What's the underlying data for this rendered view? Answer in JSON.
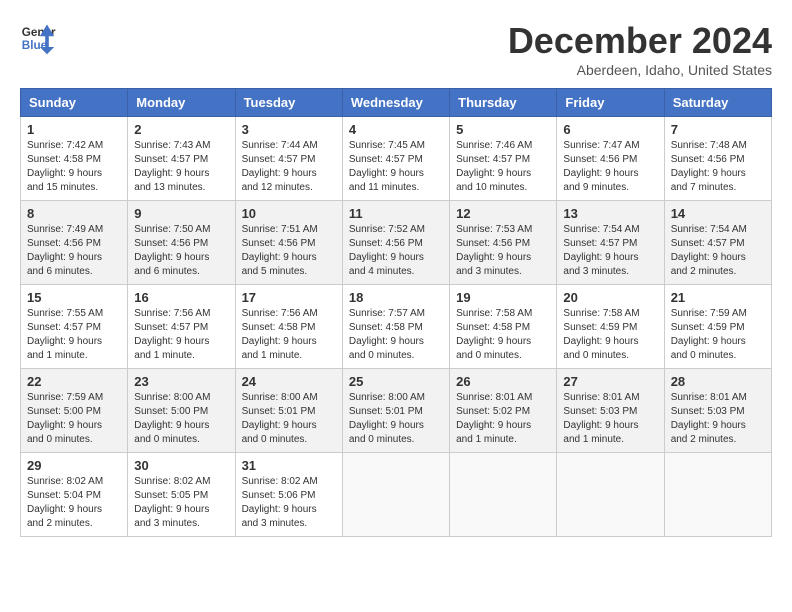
{
  "header": {
    "logo_line1": "General",
    "logo_line2": "Blue",
    "title": "December 2024",
    "subtitle": "Aberdeen, Idaho, United States"
  },
  "columns": [
    "Sunday",
    "Monday",
    "Tuesday",
    "Wednesday",
    "Thursday",
    "Friday",
    "Saturday"
  ],
  "weeks": [
    [
      {
        "day": "1",
        "sunrise": "7:42 AM",
        "sunset": "4:58 PM",
        "daylight": "9 hours and 15 minutes."
      },
      {
        "day": "2",
        "sunrise": "7:43 AM",
        "sunset": "4:57 PM",
        "daylight": "9 hours and 13 minutes."
      },
      {
        "day": "3",
        "sunrise": "7:44 AM",
        "sunset": "4:57 PM",
        "daylight": "9 hours and 12 minutes."
      },
      {
        "day": "4",
        "sunrise": "7:45 AM",
        "sunset": "4:57 PM",
        "daylight": "9 hours and 11 minutes."
      },
      {
        "day": "5",
        "sunrise": "7:46 AM",
        "sunset": "4:57 PM",
        "daylight": "9 hours and 10 minutes."
      },
      {
        "day": "6",
        "sunrise": "7:47 AM",
        "sunset": "4:56 PM",
        "daylight": "9 hours and 9 minutes."
      },
      {
        "day": "7",
        "sunrise": "7:48 AM",
        "sunset": "4:56 PM",
        "daylight": "9 hours and 7 minutes."
      }
    ],
    [
      {
        "day": "8",
        "sunrise": "7:49 AM",
        "sunset": "4:56 PM",
        "daylight": "9 hours and 6 minutes."
      },
      {
        "day": "9",
        "sunrise": "7:50 AM",
        "sunset": "4:56 PM",
        "daylight": "9 hours and 6 minutes."
      },
      {
        "day": "10",
        "sunrise": "7:51 AM",
        "sunset": "4:56 PM",
        "daylight": "9 hours and 5 minutes."
      },
      {
        "day": "11",
        "sunrise": "7:52 AM",
        "sunset": "4:56 PM",
        "daylight": "9 hours and 4 minutes."
      },
      {
        "day": "12",
        "sunrise": "7:53 AM",
        "sunset": "4:56 PM",
        "daylight": "9 hours and 3 minutes."
      },
      {
        "day": "13",
        "sunrise": "7:54 AM",
        "sunset": "4:57 PM",
        "daylight": "9 hours and 3 minutes."
      },
      {
        "day": "14",
        "sunrise": "7:54 AM",
        "sunset": "4:57 PM",
        "daylight": "9 hours and 2 minutes."
      }
    ],
    [
      {
        "day": "15",
        "sunrise": "7:55 AM",
        "sunset": "4:57 PM",
        "daylight": "9 hours and 1 minute."
      },
      {
        "day": "16",
        "sunrise": "7:56 AM",
        "sunset": "4:57 PM",
        "daylight": "9 hours and 1 minute."
      },
      {
        "day": "17",
        "sunrise": "7:56 AM",
        "sunset": "4:58 PM",
        "daylight": "9 hours and 1 minute."
      },
      {
        "day": "18",
        "sunrise": "7:57 AM",
        "sunset": "4:58 PM",
        "daylight": "9 hours and 0 minutes."
      },
      {
        "day": "19",
        "sunrise": "7:58 AM",
        "sunset": "4:58 PM",
        "daylight": "9 hours and 0 minutes."
      },
      {
        "day": "20",
        "sunrise": "7:58 AM",
        "sunset": "4:59 PM",
        "daylight": "9 hours and 0 minutes."
      },
      {
        "day": "21",
        "sunrise": "7:59 AM",
        "sunset": "4:59 PM",
        "daylight": "9 hours and 0 minutes."
      }
    ],
    [
      {
        "day": "22",
        "sunrise": "7:59 AM",
        "sunset": "5:00 PM",
        "daylight": "9 hours and 0 minutes."
      },
      {
        "day": "23",
        "sunrise": "8:00 AM",
        "sunset": "5:00 PM",
        "daylight": "9 hours and 0 minutes."
      },
      {
        "day": "24",
        "sunrise": "8:00 AM",
        "sunset": "5:01 PM",
        "daylight": "9 hours and 0 minutes."
      },
      {
        "day": "25",
        "sunrise": "8:00 AM",
        "sunset": "5:01 PM",
        "daylight": "9 hours and 0 minutes."
      },
      {
        "day": "26",
        "sunrise": "8:01 AM",
        "sunset": "5:02 PM",
        "daylight": "9 hours and 1 minute."
      },
      {
        "day": "27",
        "sunrise": "8:01 AM",
        "sunset": "5:03 PM",
        "daylight": "9 hours and 1 minute."
      },
      {
        "day": "28",
        "sunrise": "8:01 AM",
        "sunset": "5:03 PM",
        "daylight": "9 hours and 2 minutes."
      }
    ],
    [
      {
        "day": "29",
        "sunrise": "8:02 AM",
        "sunset": "5:04 PM",
        "daylight": "9 hours and 2 minutes."
      },
      {
        "day": "30",
        "sunrise": "8:02 AM",
        "sunset": "5:05 PM",
        "daylight": "9 hours and 3 minutes."
      },
      {
        "day": "31",
        "sunrise": "8:02 AM",
        "sunset": "5:06 PM",
        "daylight": "9 hours and 3 minutes."
      },
      null,
      null,
      null,
      null
    ]
  ]
}
